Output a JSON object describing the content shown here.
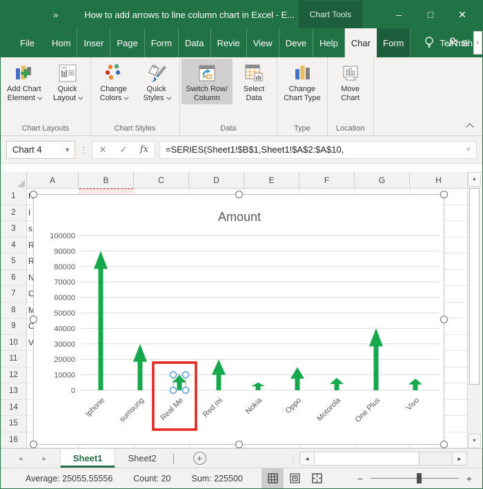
{
  "colors": {
    "excel_green": "#217346",
    "contextual_green": "#1d5f3c",
    "arrow_green": "#17a74d",
    "annotation_red": "#e3231a",
    "handle_blue": "#5b9bd5",
    "grid_line": "#d9d9d9",
    "axis_text": "#595959"
  },
  "titlebar": {
    "title": "How to add arrows to line  column chart in Excel  -  E...",
    "context_label": "Chart Tools"
  },
  "icons": {
    "qat_expand": "»",
    "minimize": "–",
    "maximize": "□",
    "close": "✕",
    "cancel": "✕",
    "enter": "✓",
    "function": "fx",
    "dropdown": "▼",
    "chevron_down": "˅",
    "chevron_right": "›",
    "left_arrow": "◄",
    "right_arrow": "►",
    "up_arrow": "▲",
    "down_arrow": "▼",
    "plus": "+",
    "dots": "⋮",
    "zoom_out": "−",
    "zoom_in": "+"
  },
  "menu": {
    "tabs": [
      {
        "label": "File"
      },
      {
        "label": "Hom"
      },
      {
        "label": "Inser"
      },
      {
        "label": "Page"
      },
      {
        "label": "Form"
      },
      {
        "label": "Data"
      },
      {
        "label": "Revie"
      },
      {
        "label": "View"
      },
      {
        "label": "Deve"
      },
      {
        "label": "Help"
      },
      {
        "label": "Char",
        "active": true
      },
      {
        "label": "Form",
        "contextual": true
      }
    ],
    "tell_me": "Tell me",
    "share": "Sh"
  },
  "ribbon": {
    "groups": [
      {
        "label": "Chart Layouts",
        "buttons": [
          {
            "line1": "Add Chart",
            "line2": "Element",
            "dropdown": true
          },
          {
            "line1": "Quick",
            "line2": "Layout",
            "dropdown": true
          }
        ]
      },
      {
        "label": "Chart Styles",
        "buttons": [
          {
            "line1": "Change",
            "line2": "Colors",
            "dropdown": true
          },
          {
            "line1": "Quick",
            "line2": "Styles",
            "dropdown": true
          }
        ]
      },
      {
        "label": "Data",
        "buttons": [
          {
            "line1": "Switch Row/",
            "line2": "Column",
            "highlighted": true
          },
          {
            "line1": "Select",
            "line2": "Data"
          }
        ]
      },
      {
        "label": "Type",
        "buttons": [
          {
            "line1": "Change",
            "line2": "Chart Type"
          }
        ]
      },
      {
        "label": "Location",
        "buttons": [
          {
            "line1": "Move",
            "line2": "Chart"
          }
        ]
      }
    ]
  },
  "formula_bar": {
    "name_box": "Chart 4",
    "formula": "=SERIES(Sheet1!$B$1,Sheet1!$A$2:$A$10,"
  },
  "grid": {
    "column_headers": [
      "A",
      "B",
      "C",
      "D",
      "E",
      "F",
      "G",
      "H"
    ],
    "row_numbers": [
      "1",
      "2",
      "3",
      "4",
      "5",
      "6",
      "7",
      "8",
      "9",
      "10",
      "11",
      "12",
      "13",
      "14",
      "15",
      "16"
    ],
    "col_a_fragments": [
      {
        "row": 1,
        "text": "N"
      },
      {
        "row": 2,
        "text": "I"
      },
      {
        "row": 3,
        "text": "s"
      },
      {
        "row": 4,
        "text": "R"
      },
      {
        "row": 5,
        "text": "R"
      },
      {
        "row": 6,
        "text": "N"
      },
      {
        "row": 7,
        "text": "O"
      },
      {
        "row": 8,
        "text": "M"
      },
      {
        "row": 9,
        "text": "O"
      },
      {
        "row": 10,
        "text": "V"
      }
    ]
  },
  "chart_data": {
    "type": "bar",
    "bar_style": "up-arrow",
    "title": "Amount",
    "categories": [
      "Iphone",
      "sumsung",
      "Real Me",
      "Red mi",
      "Nokia",
      "Oppo",
      "Motorola",
      "One Plus",
      "Vivo"
    ],
    "values": [
      90000,
      30000,
      10000,
      20000,
      5000,
      15000,
      8000,
      40000,
      7500
    ],
    "ylim": [
      0,
      100000
    ],
    "ytick_step": 10000,
    "yticks": [
      0,
      10000,
      20000,
      30000,
      40000,
      50000,
      60000,
      70000,
      80000,
      90000,
      100000
    ],
    "grid": true,
    "legend": false,
    "xlabel": "",
    "ylabel": "",
    "selected_index": 2,
    "annotation": "red rectangle highlighting the Real Me arrow and its axis label"
  },
  "sheet_bar": {
    "tabs": [
      {
        "label": "Sheet1",
        "active": true
      },
      {
        "label": "Sheet2"
      }
    ]
  },
  "status_bar": {
    "average": "Average: 25055.55556",
    "count": "Count: 20",
    "sum": "Sum: 225500"
  }
}
